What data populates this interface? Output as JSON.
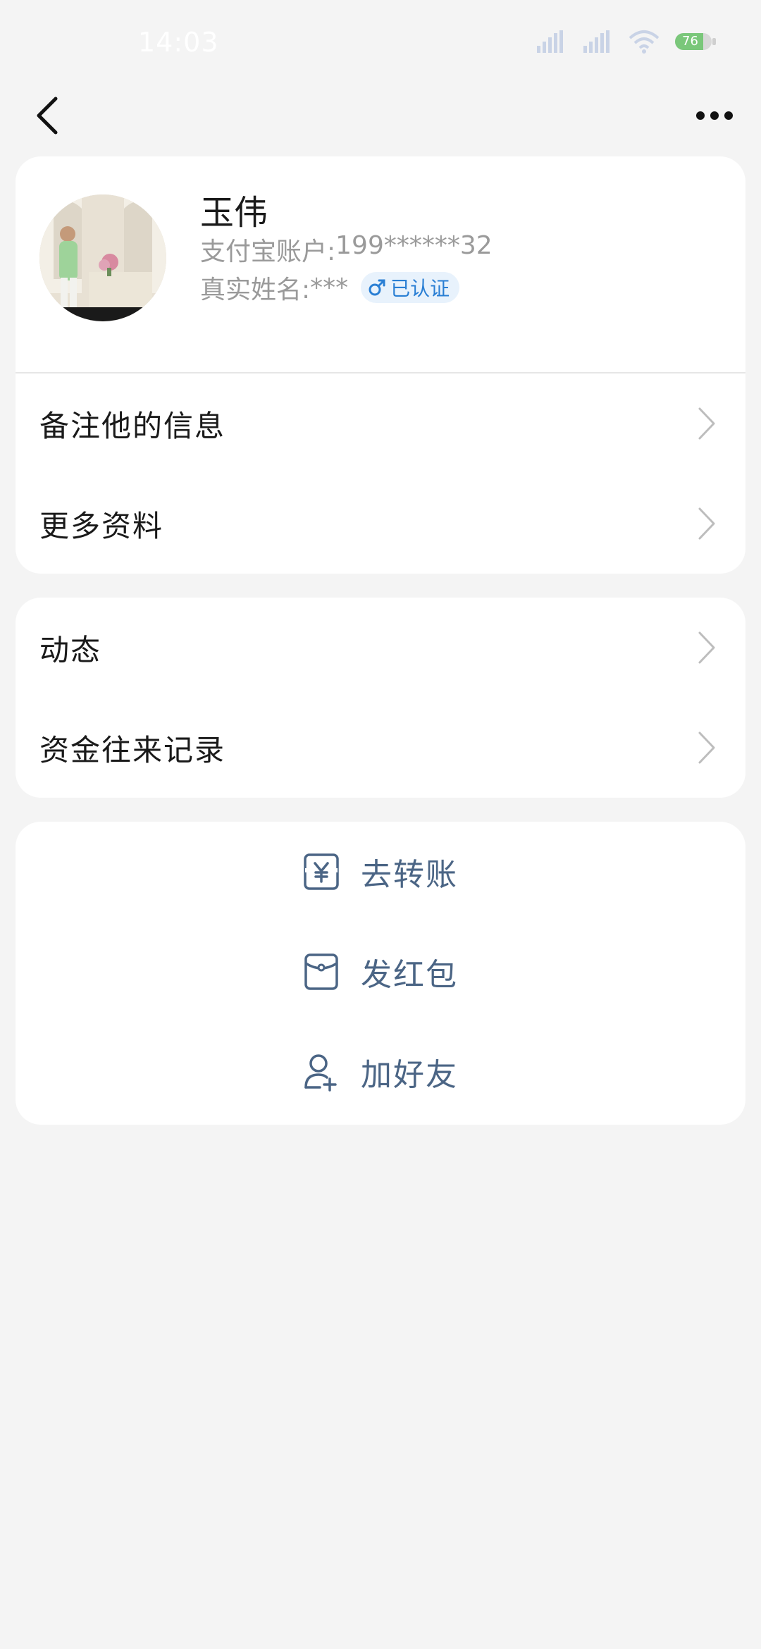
{
  "status_bar": {
    "time": "14:03",
    "battery": "76"
  },
  "header": {
    "back_icon": "chevron-left-icon",
    "more_icon": "more-horizontal-icon"
  },
  "profile": {
    "name": "玉伟",
    "account_label": "支付宝账户:",
    "account_value": "199******32",
    "realname_label": "真实姓名:",
    "realname_value": "***",
    "verified_label": "已认证",
    "gender_icon": "male-icon",
    "verified_color": "#2a7fd4"
  },
  "profile_menu": [
    {
      "label": "备注他的信息"
    },
    {
      "label": "更多资料"
    }
  ],
  "activity_menu": [
    {
      "label": "动态"
    },
    {
      "label": "资金往来记录"
    }
  ],
  "actions": [
    {
      "label": "去转账",
      "icon": "transfer-yuan-icon"
    },
    {
      "label": "发红包",
      "icon": "red-packet-icon"
    },
    {
      "label": "加好友",
      "icon": "add-friend-icon"
    }
  ],
  "colors": {
    "background": "#f4f4f4",
    "action_text": "#4b6585",
    "secondary_text": "#9a9a9a"
  }
}
